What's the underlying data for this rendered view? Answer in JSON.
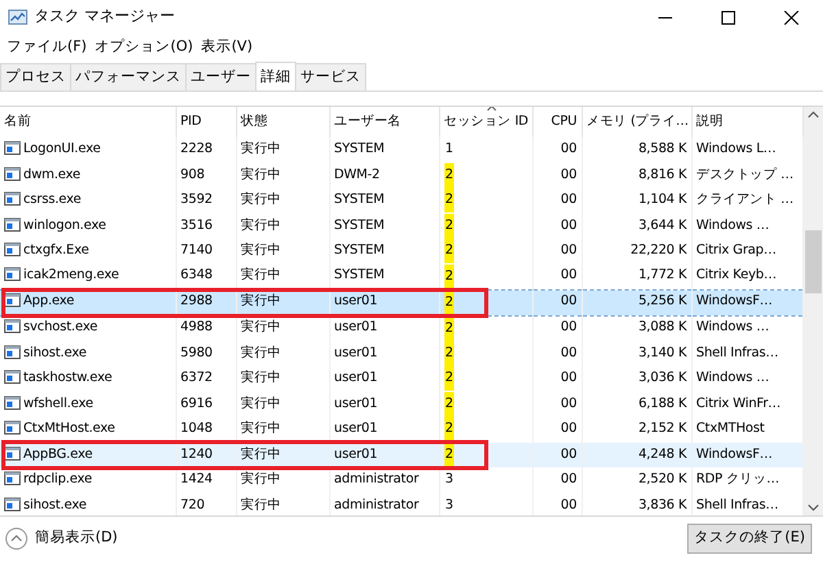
{
  "window": {
    "title": "タスク マネージャー"
  },
  "menu": [
    "ファイル(F)",
    "オプション(O)",
    "表示(V)"
  ],
  "tabs": [
    {
      "label": "プロセス",
      "selected": false
    },
    {
      "label": "パフォーマンス",
      "selected": false
    },
    {
      "label": "ユーザー",
      "selected": false
    },
    {
      "label": "詳細",
      "selected": true
    },
    {
      "label": "サービス",
      "selected": false
    }
  ],
  "table": {
    "columns": [
      "名前",
      "PID",
      "状態",
      "ユーザー名",
      "セッション ID",
      "CPU",
      "メモリ (プライ…",
      "説明"
    ],
    "rows": [
      {
        "cells": [
          "LogonUI.exe",
          "2228",
          "実行中",
          "SYSTEM",
          "1",
          "00",
          "8,588 K",
          "Windows L…"
        ],
        "selected": false,
        "hot": false,
        "boxed": false,
        "marked": false
      },
      {
        "cells": [
          "dwm.exe",
          "908",
          "実行中",
          "DWM-2",
          "2",
          "00",
          "8,816 K",
          "デスクトップ …"
        ],
        "selected": false,
        "hot": false,
        "boxed": false,
        "marked": true
      },
      {
        "cells": [
          "csrss.exe",
          "3592",
          "実行中",
          "SYSTEM",
          "2",
          "00",
          "1,104 K",
          "クライアント …"
        ],
        "selected": false,
        "hot": false,
        "boxed": false,
        "marked": true
      },
      {
        "cells": [
          "winlogon.exe",
          "3516",
          "実行中",
          "SYSTEM",
          "2",
          "00",
          "3,644 K",
          "Windows …"
        ],
        "selected": false,
        "hot": false,
        "boxed": false,
        "marked": true
      },
      {
        "cells": [
          "ctxgfx.Exe",
          "7140",
          "実行中",
          "SYSTEM",
          "2",
          "00",
          "22,220 K",
          "Citrix Grap…"
        ],
        "selected": false,
        "hot": false,
        "boxed": false,
        "marked": true
      },
      {
        "cells": [
          "icak2meng.exe",
          "6348",
          "実行中",
          "SYSTEM",
          "2",
          "00",
          "1,772 K",
          "Citrix Keyb…"
        ],
        "selected": false,
        "hot": false,
        "boxed": false,
        "marked": true
      },
      {
        "cells": [
          "App.exe",
          "2988",
          "実行中",
          "user01",
          "2",
          "00",
          "5,256 K",
          "WindowsF…"
        ],
        "selected": true,
        "hot": false,
        "boxed": true,
        "marked": true
      },
      {
        "cells": [
          "svchost.exe",
          "4988",
          "実行中",
          "user01",
          "2",
          "00",
          "3,088 K",
          "Windows …"
        ],
        "selected": false,
        "hot": false,
        "boxed": false,
        "marked": true
      },
      {
        "cells": [
          "sihost.exe",
          "5980",
          "実行中",
          "user01",
          "2",
          "00",
          "3,140 K",
          "Shell Infras…"
        ],
        "selected": false,
        "hot": false,
        "boxed": false,
        "marked": true
      },
      {
        "cells": [
          "taskhostw.exe",
          "6372",
          "実行中",
          "user01",
          "2",
          "00",
          "3,036 K",
          "Windows …"
        ],
        "selected": false,
        "hot": false,
        "boxed": false,
        "marked": true
      },
      {
        "cells": [
          "wfshell.exe",
          "6916",
          "実行中",
          "user01",
          "2",
          "00",
          "6,188 K",
          "Citrix WinFr…"
        ],
        "selected": false,
        "hot": false,
        "boxed": false,
        "marked": true
      },
      {
        "cells": [
          "CtxMtHost.exe",
          "1048",
          "実行中",
          "user01",
          "2",
          "00",
          "2,152 K",
          "CtxMTHost"
        ],
        "selected": false,
        "hot": false,
        "boxed": false,
        "marked": true
      },
      {
        "cells": [
          "AppBG.exe",
          "1240",
          "実行中",
          "user01",
          "2",
          "00",
          "4,248 K",
          "WindowsF…"
        ],
        "selected": false,
        "hot": true,
        "boxed": true,
        "marked": true
      },
      {
        "cells": [
          "rdpclip.exe",
          "1424",
          "実行中",
          "administrator",
          "3",
          "00",
          "2,520 K",
          "RDP クリッ…"
        ],
        "selected": false,
        "hot": false,
        "boxed": false,
        "marked": false
      },
      {
        "cells": [
          "sihost.exe",
          "720",
          "実行中",
          "administrator",
          "3",
          "00",
          "3,836 K",
          "Shell Infras…"
        ],
        "selected": false,
        "hot": false,
        "boxed": false,
        "marked": false
      }
    ]
  },
  "footer": {
    "toggle": "簡易表示(D)",
    "end_task": "タスクの終了(E)"
  }
}
